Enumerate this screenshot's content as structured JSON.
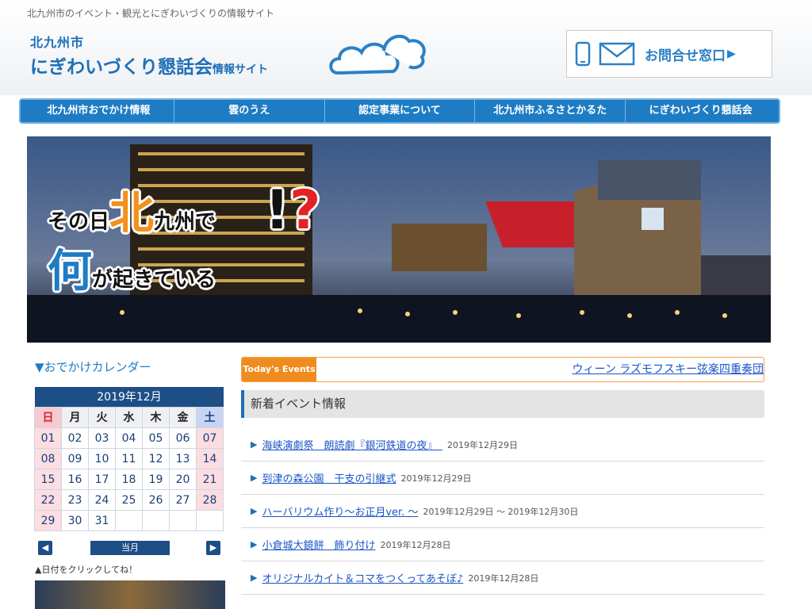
{
  "header": {
    "tagline": "北九州市のイベント・観光とにぎわいづくりの情報サイト",
    "logo_line1": "北九州市",
    "logo_line2": "にぎわいづくり懇話会",
    "logo_suffix": "情報サイト",
    "contact_label": "お問合せ窓口"
  },
  "nav": {
    "items": [
      "北九州市おでかけ情報",
      "雲のうえ",
      "認定事業について",
      "北九州市ふるさとかるた",
      "にぎわいづくり懇話会"
    ]
  },
  "hero": {
    "line1_a": "その日",
    "line1_kita": "北",
    "line1_b": "九州で",
    "line2_nani": "何",
    "line2_b": "が起きている",
    "mark_ex": "!",
    "mark_q": "?"
  },
  "sidebar": {
    "title": "▼おでかけカレンダー",
    "calendar": {
      "month": "2019年12月",
      "weekdays": [
        "日",
        "月",
        "火",
        "水",
        "木",
        "金",
        "土"
      ],
      "weeks": [
        [
          "01",
          "02",
          "03",
          "04",
          "05",
          "06",
          "07"
        ],
        [
          "08",
          "09",
          "10",
          "11",
          "12",
          "13",
          "14"
        ],
        [
          "15",
          "16",
          "17",
          "18",
          "19",
          "20",
          "21"
        ],
        [
          "22",
          "23",
          "24",
          "25",
          "26",
          "27",
          "28"
        ],
        [
          "29",
          "30",
          "31",
          "",
          "",
          "",
          ""
        ]
      ],
      "prev": "◀",
      "next": "▶",
      "today_button": "当月"
    },
    "note": "▲日付をクリックしてね！"
  },
  "events": {
    "label": "Today's Events",
    "ticker": "ウィーン ラズモフスキー弦楽四重奏団"
  },
  "news": {
    "heading": "新着イベント情報",
    "items": [
      {
        "title": "海峡演劇祭　朗読劇『銀河鉄道の夜』　",
        "date": "2019年12月29日"
      },
      {
        "title": "到津の森公園　干支の引継式",
        "date": "2019年12月29日"
      },
      {
        "title": "ハーバリウム作り～お正月ver. ～",
        "date": "2019年12月29日 ～ 2019年12月30日"
      },
      {
        "title": "小倉城大鏡餅　飾り付け",
        "date": "2019年12月28日"
      },
      {
        "title": "オリジナルカイト＆コマをつくってあそぼ♪",
        "date": "2019年12月28日"
      }
    ]
  }
}
